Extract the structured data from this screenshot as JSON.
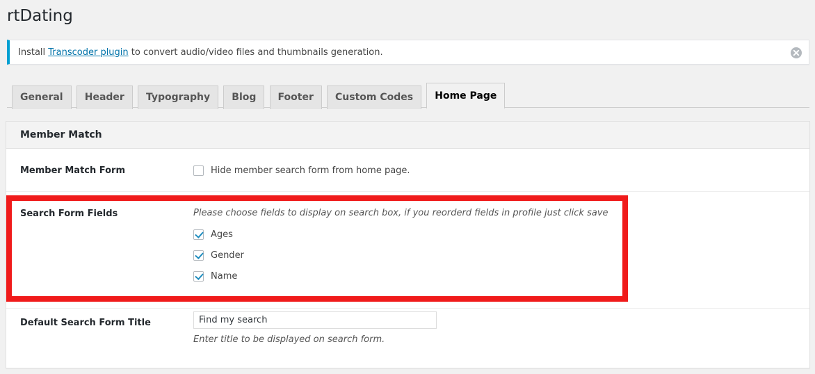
{
  "page": {
    "title": "rtDating"
  },
  "notice": {
    "text_before": "Install ",
    "link_label": "Transcoder plugin",
    "text_after": " to convert audio/video files and thumbnails generation.",
    "dismiss_icon": "dismiss-circle-icon",
    "accent_color": "#00a0d2"
  },
  "tabs": [
    {
      "label": "General",
      "active": false
    },
    {
      "label": "Header",
      "active": false
    },
    {
      "label": "Typography",
      "active": false
    },
    {
      "label": "Blog",
      "active": false
    },
    {
      "label": "Footer",
      "active": false
    },
    {
      "label": "Custom Codes",
      "active": false
    },
    {
      "label": "Home Page",
      "active": true
    }
  ],
  "panel": {
    "header_title": "Member Match",
    "rows": {
      "member_match_form": {
        "label": "Member Match Form",
        "checkbox_label": "Hide member search form from home page.",
        "checked": false
      },
      "search_form_fields": {
        "label": "Search Form Fields",
        "help": "Please choose fields to display on search box, if you reorderd fields in profile just click save",
        "fields": [
          {
            "label": "Ages",
            "checked": true
          },
          {
            "label": "Gender",
            "checked": true
          },
          {
            "label": "Name",
            "checked": true
          }
        ]
      },
      "default_search_form_title": {
        "label": "Default Search Form Title",
        "value": "Find my search",
        "placeholder": "",
        "help": "Enter title to be displayed on search form."
      }
    }
  },
  "annotation": {
    "highlight_color": "#f01b1b"
  }
}
